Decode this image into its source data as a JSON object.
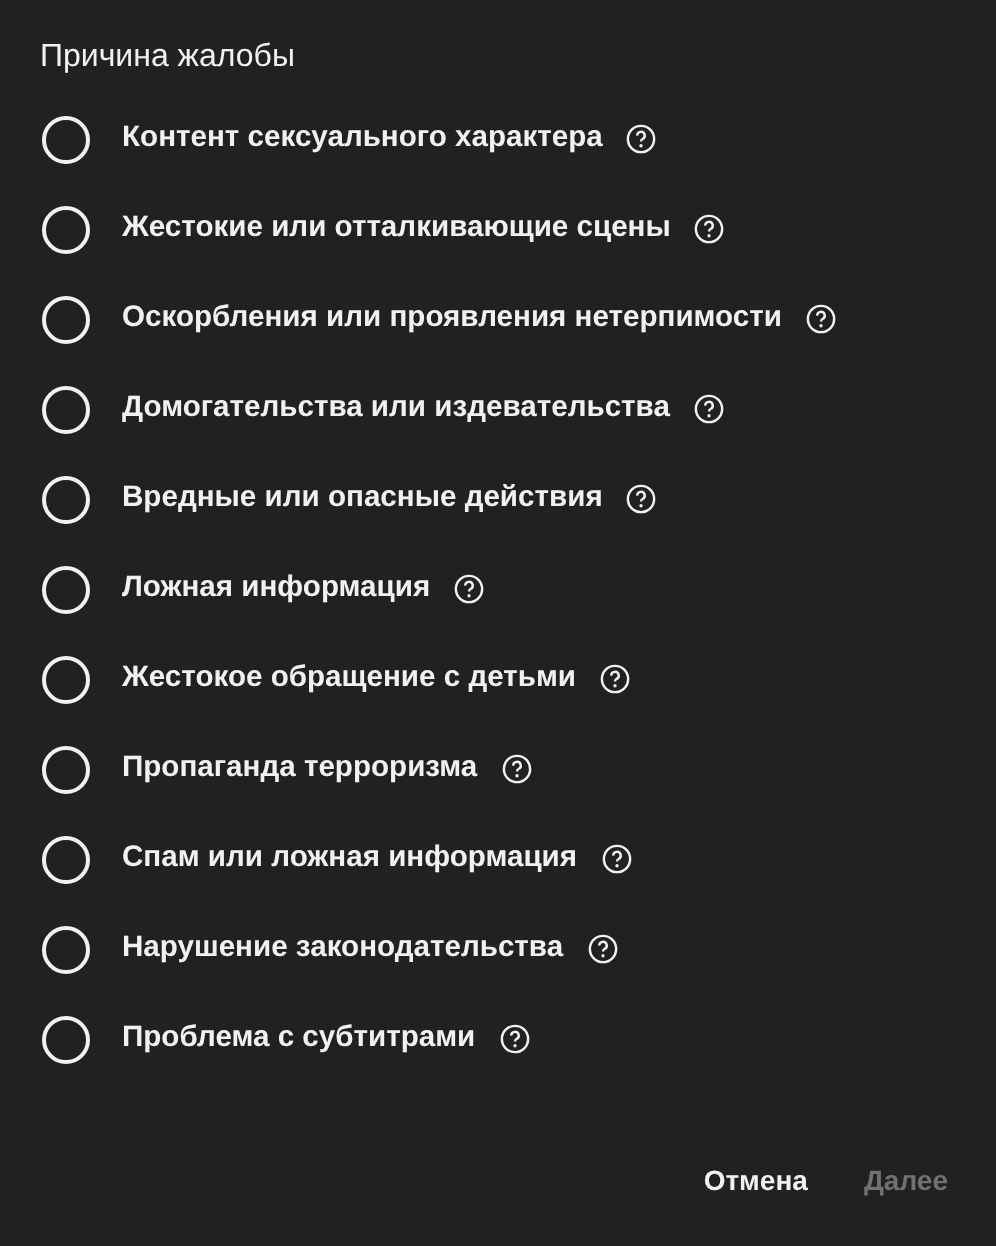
{
  "dialog": {
    "title": "Причина жалобы",
    "options": [
      {
        "label": "Контент сексуального характера",
        "selected": false
      },
      {
        "label": "Жестокие или отталкивающие сцены",
        "selected": false
      },
      {
        "label": "Оскорбления или проявления нетерпимости",
        "selected": false
      },
      {
        "label": "Домогательства или издевательства",
        "selected": false
      },
      {
        "label": "Вредные или опасные действия",
        "selected": false
      },
      {
        "label": "Ложная информация",
        "selected": false
      },
      {
        "label": "Жестокое обращение с детьми",
        "selected": false
      },
      {
        "label": "Пропаганда терроризма",
        "selected": false
      },
      {
        "label": "Спам или ложная информация",
        "selected": false
      },
      {
        "label": "Нарушение законодательства",
        "selected": false
      },
      {
        "label": "Проблема с субтитрами",
        "selected": false
      }
    ],
    "buttons": [
      {
        "label": "Отмена",
        "disabled": false
      },
      {
        "label": "Далее",
        "disabled": true
      }
    ]
  }
}
